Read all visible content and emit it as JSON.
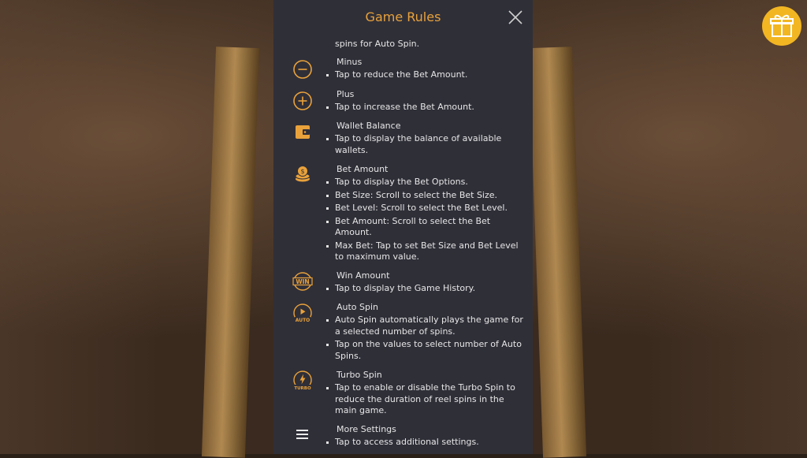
{
  "header": {
    "title": "Game Rules"
  },
  "partial_text": "spins for Auto Spin.",
  "rules": [
    {
      "name": "Minus",
      "icon": "minus-icon",
      "items": [
        "Tap to reduce the Bet Amount."
      ]
    },
    {
      "name": "Plus",
      "icon": "plus-icon",
      "items": [
        "Tap to increase the Bet Amount."
      ]
    },
    {
      "name": "Wallet Balance",
      "icon": "wallet-icon",
      "items": [
        "Tap to display the balance of available wallets."
      ]
    },
    {
      "name": "Bet Amount",
      "icon": "coins-icon",
      "items": [
        "Tap to display the Bet Options.",
        "Bet Size: Scroll to select the Bet Size.",
        "Bet Level: Scroll to select the Bet Level.",
        "Bet Amount: Scroll to select the Bet Amount.",
        "Max Bet: Tap to set Bet Size and Bet Level to maximum value."
      ]
    },
    {
      "name": "Win Amount",
      "icon": "win-icon",
      "icon_text": "WIN",
      "items": [
        "Tap to display the Game History."
      ]
    },
    {
      "name": "Auto Spin",
      "icon": "auto-spin-icon",
      "icon_text": "AUTO",
      "items": [
        "Auto Spin automatically plays the game for a selected number of spins.",
        "Tap on the values to select number of Auto Spins."
      ]
    },
    {
      "name": "Turbo Spin",
      "icon": "turbo-spin-icon",
      "icon_text": "TURBO",
      "items": [
        "Tap to enable or disable the Turbo Spin to reduce the duration of reel spins in the main game."
      ]
    },
    {
      "name": "More Settings",
      "icon": "menu-icon",
      "items": [
        "Tap to access additional settings."
      ]
    }
  ],
  "colors": {
    "accent": "#e9a23b",
    "panel": "#2f2f38",
    "text": "#e6e6e6",
    "gift": "#f2b623"
  }
}
